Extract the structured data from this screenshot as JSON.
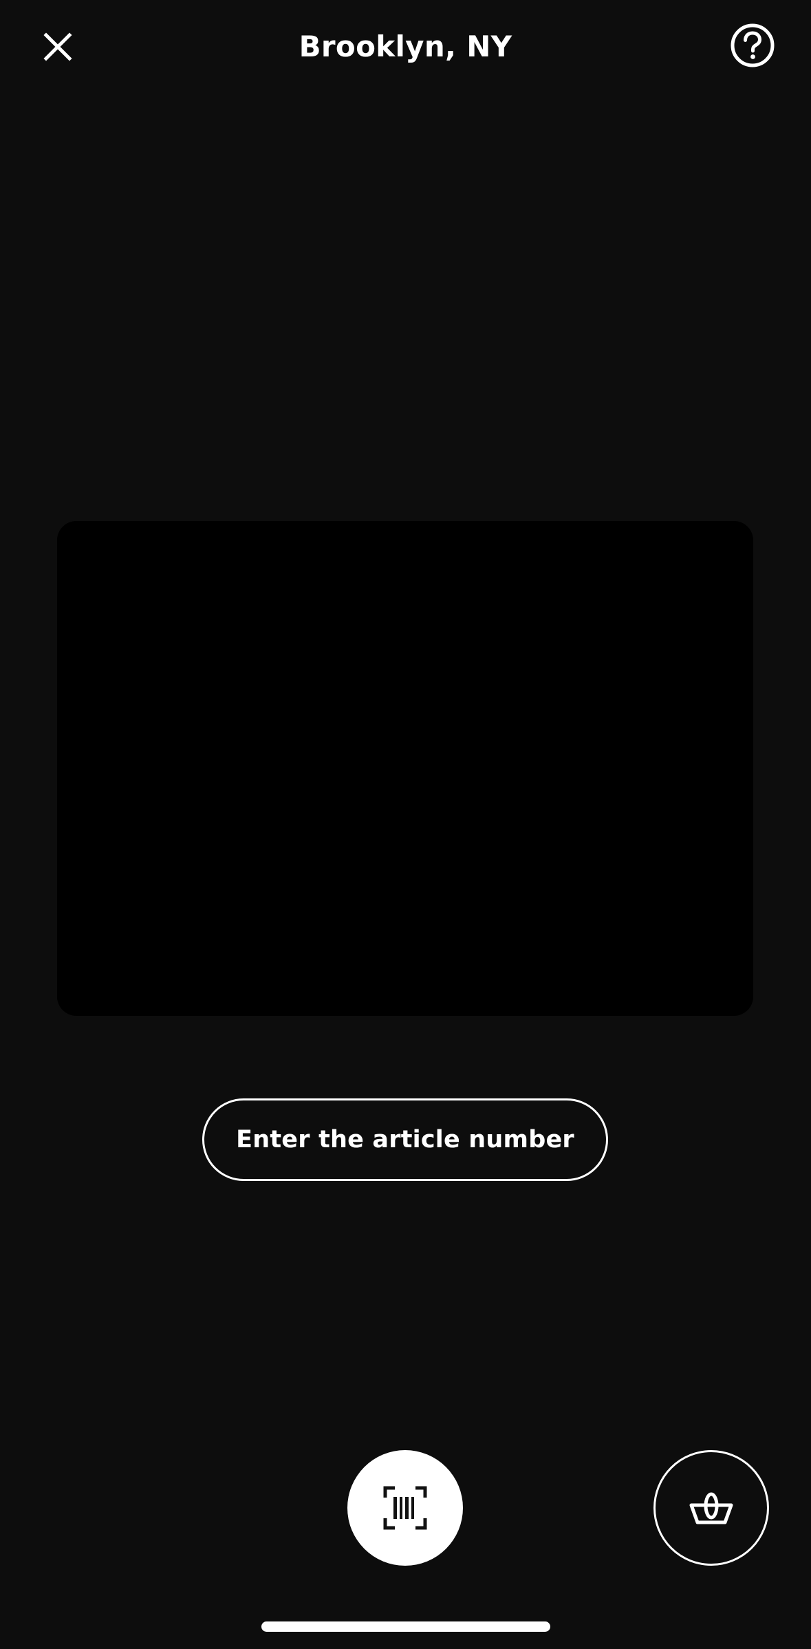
{
  "header": {
    "title": "Brooklyn, NY",
    "close_icon": "close-icon",
    "help_icon": "question-circle-icon"
  },
  "main": {
    "article_button_label": "Enter the article number"
  },
  "bottom_bar": {
    "scan_icon": "barcode-scan-icon",
    "basket_icon": "basket-icon"
  },
  "colors": {
    "background": "#0d0d0d",
    "viewfinder": "#000000",
    "foreground": "#ffffff"
  }
}
